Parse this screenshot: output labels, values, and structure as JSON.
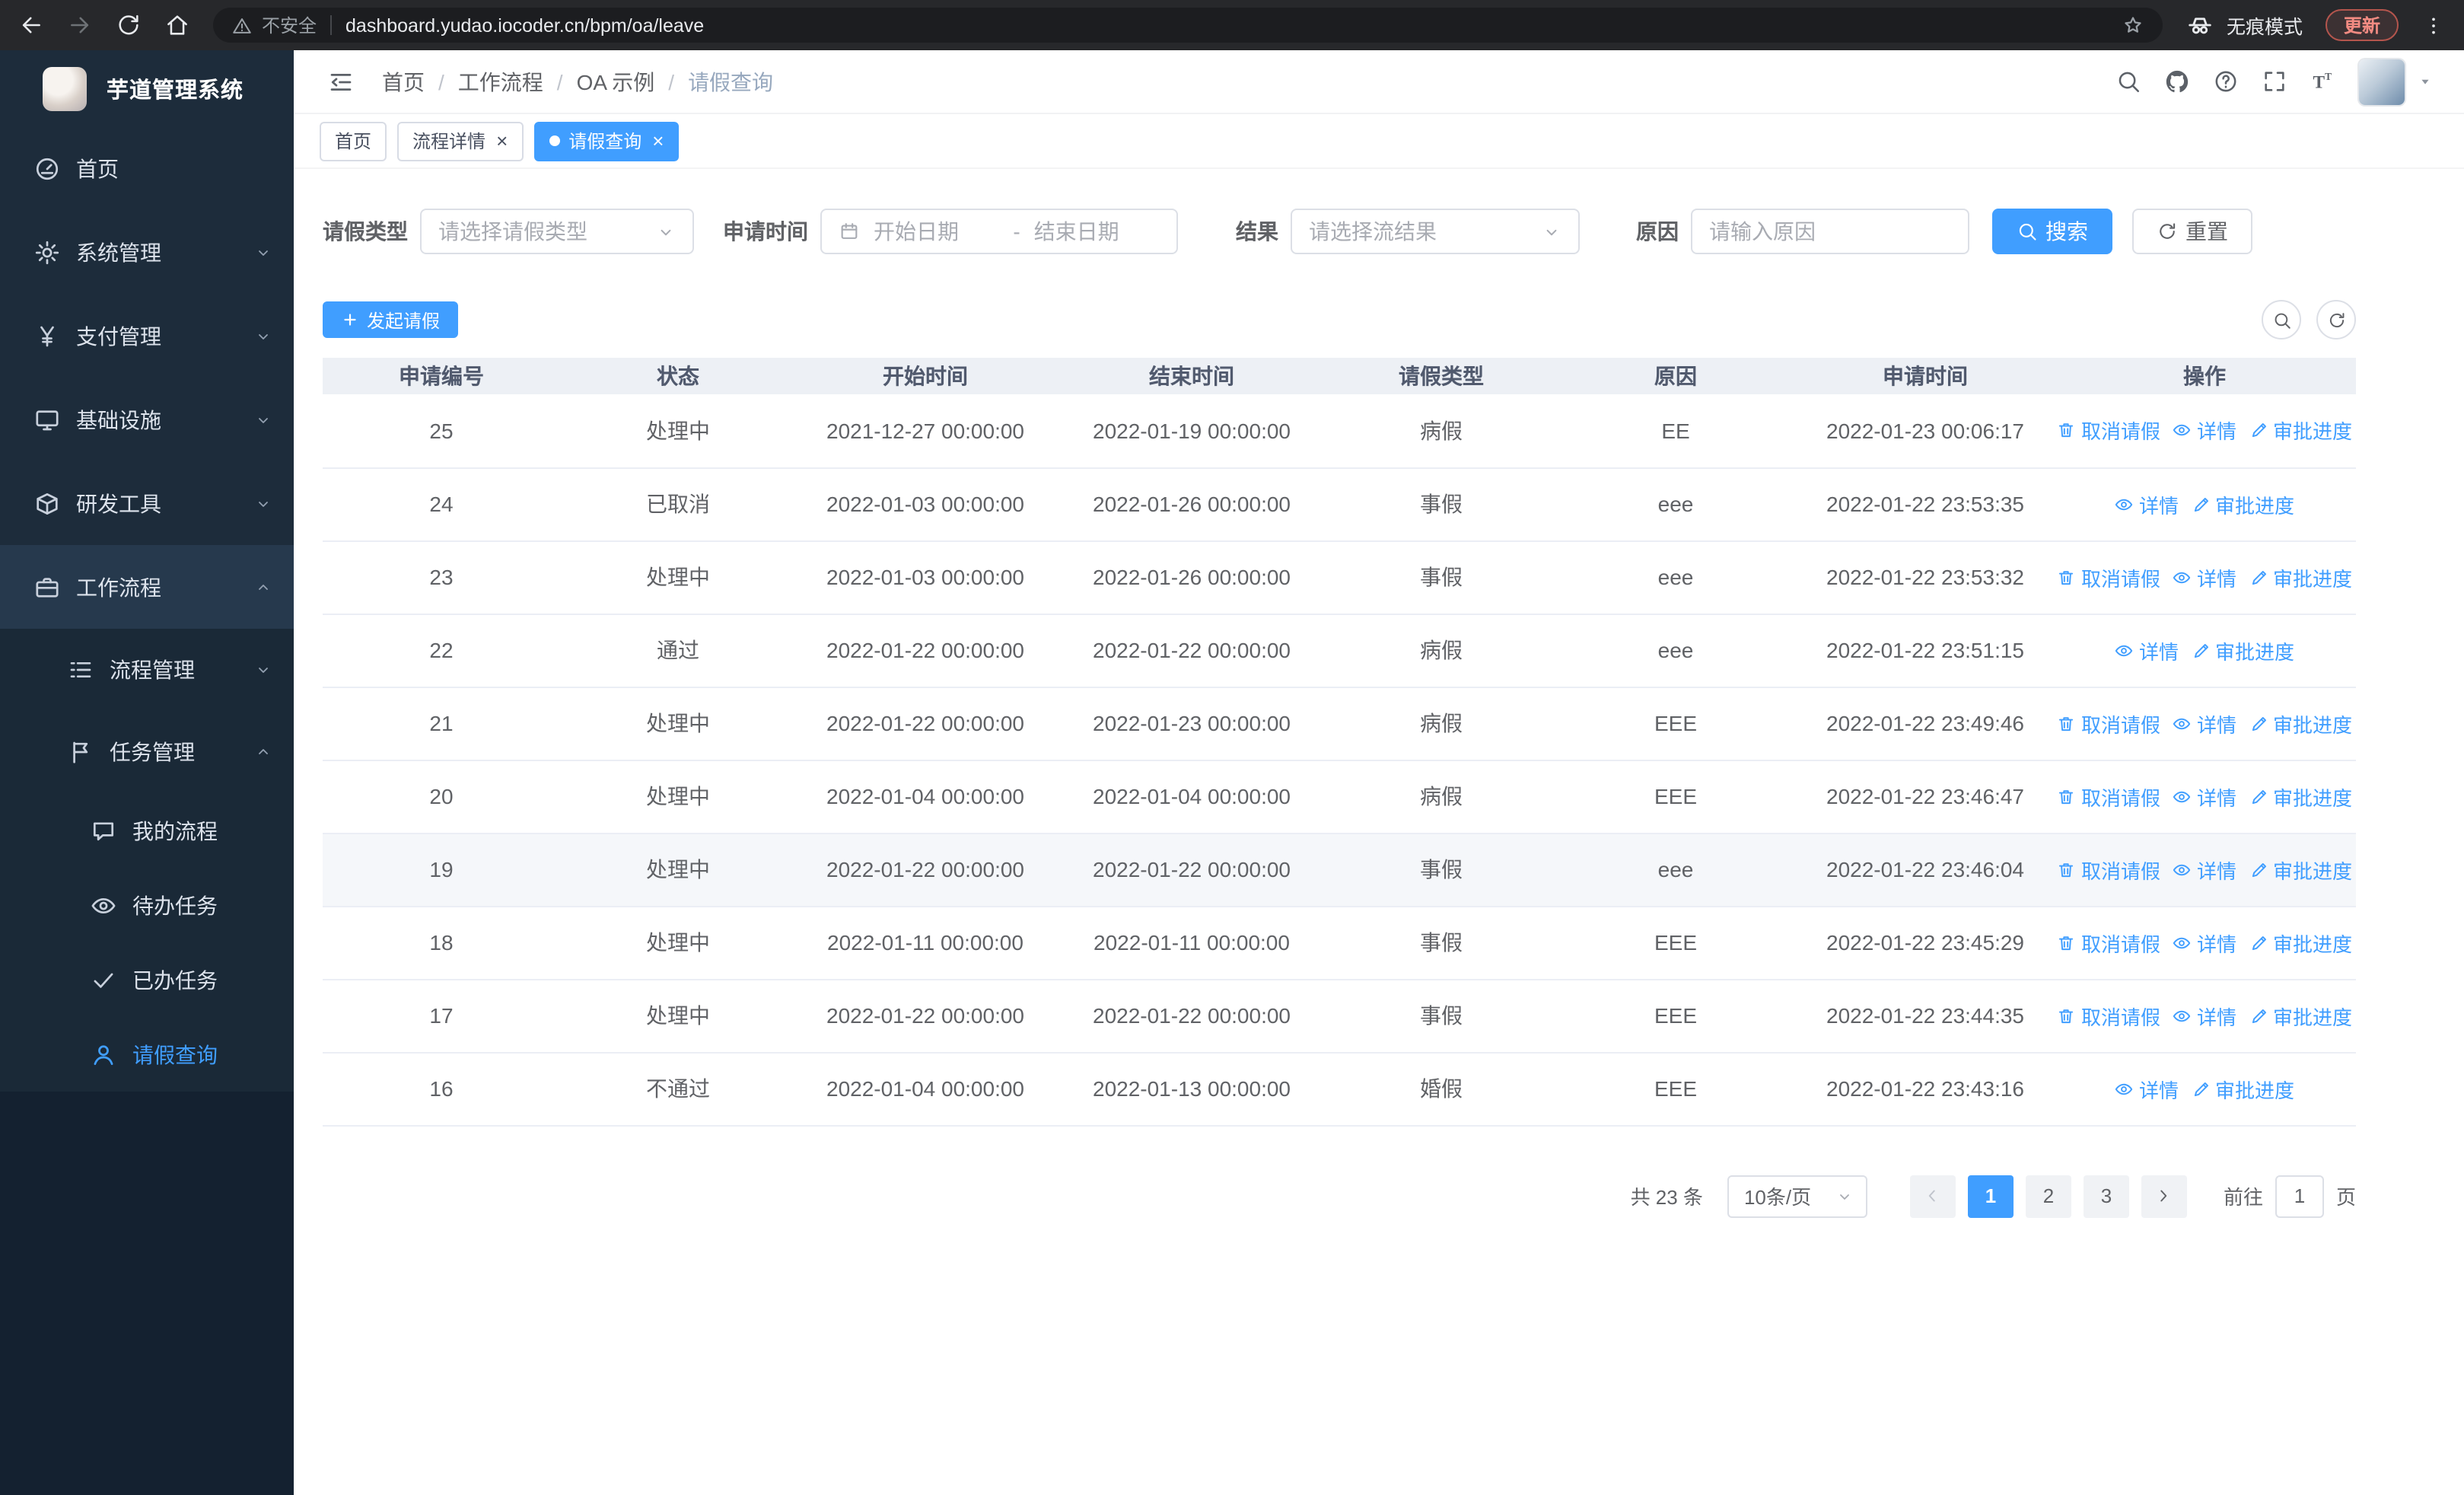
{
  "browser": {
    "security_label": "不安全",
    "url": "dashboard.yudao.iocoder.cn/bpm/oa/leave",
    "incognito_label": "无痕模式",
    "update_label": "更新"
  },
  "sidebar": {
    "logo_title": "芋道管理系统",
    "items": [
      {
        "label": "首页",
        "icon": "dashboard-icon",
        "level": 1
      },
      {
        "label": "系统管理",
        "icon": "gear-icon",
        "level": 1,
        "expandable": true
      },
      {
        "label": "支付管理",
        "icon": "yen-icon",
        "level": 1,
        "expandable": true
      },
      {
        "label": "基础设施",
        "icon": "monitor-icon",
        "level": 1,
        "expandable": true
      },
      {
        "label": "研发工具",
        "icon": "cube-icon",
        "level": 1,
        "expandable": true
      },
      {
        "label": "工作流程",
        "icon": "briefcase-icon",
        "level": 1,
        "expandable": true,
        "expanded": true,
        "highlighted": true
      },
      {
        "label": "流程管理",
        "icon": "list-icon",
        "level": 2,
        "expandable": true
      },
      {
        "label": "任务管理",
        "icon": "flag-icon",
        "level": 2,
        "expandable": true,
        "expanded": true
      },
      {
        "label": "我的流程",
        "icon": "chat-icon",
        "level": 3
      },
      {
        "label": "待办任务",
        "icon": "eye-icon",
        "level": 3
      },
      {
        "label": "已办任务",
        "icon": "check-icon",
        "level": 3
      },
      {
        "label": "请假查询",
        "icon": "user-icon",
        "level": 3,
        "active": true
      }
    ]
  },
  "header": {
    "breadcrumb": [
      "首页",
      "工作流程",
      "OA 示例",
      "请假查询"
    ]
  },
  "tabs": [
    {
      "label": "首页"
    },
    {
      "label": "流程详情",
      "closable": true
    },
    {
      "label": "请假查询",
      "closable": true,
      "active": true
    }
  ],
  "filters": {
    "leave_type_label": "请假类型",
    "leave_type_placeholder": "请选择请假类型",
    "apply_time_label": "申请时间",
    "start_date_placeholder": "开始日期",
    "range_separator": "-",
    "end_date_placeholder": "结束日期",
    "result_label": "结果",
    "result_placeholder": "请选择流结果",
    "reason_label": "原因",
    "reason_placeholder": "请输入原因",
    "search_button": "搜索",
    "reset_button": "重置"
  },
  "toolbar": {
    "create_button": "发起请假"
  },
  "table": {
    "columns": [
      "申请编号",
      "状态",
      "开始时间",
      "结束时间",
      "请假类型",
      "原因",
      "申请时间",
      "操作"
    ],
    "action_icons": {
      "取消请假": "delete-icon",
      "详情": "view-icon",
      "审批进度": "progress-icon"
    },
    "rows": [
      {
        "id": "25",
        "status": "处理中",
        "start": "2021-12-27 00:00:00",
        "end": "2022-01-19 00:00:00",
        "type": "病假",
        "reason": "EE",
        "applied": "2022-01-23 00:06:17",
        "actions": [
          "取消请假",
          "详情",
          "审批进度"
        ]
      },
      {
        "id": "24",
        "status": "已取消",
        "start": "2022-01-03 00:00:00",
        "end": "2022-01-26 00:00:00",
        "type": "事假",
        "reason": "eee",
        "applied": "2022-01-22 23:53:35",
        "actions": [
          "详情",
          "审批进度"
        ]
      },
      {
        "id": "23",
        "status": "处理中",
        "start": "2022-01-03 00:00:00",
        "end": "2022-01-26 00:00:00",
        "type": "事假",
        "reason": "eee",
        "applied": "2022-01-22 23:53:32",
        "actions": [
          "取消请假",
          "详情",
          "审批进度"
        ]
      },
      {
        "id": "22",
        "status": "通过",
        "start": "2022-01-22 00:00:00",
        "end": "2022-01-22 00:00:00",
        "type": "病假",
        "reason": "eee",
        "applied": "2022-01-22 23:51:15",
        "actions": [
          "详情",
          "审批进度"
        ]
      },
      {
        "id": "21",
        "status": "处理中",
        "start": "2022-01-22 00:00:00",
        "end": "2022-01-23 00:00:00",
        "type": "病假",
        "reason": "EEE",
        "applied": "2022-01-22 23:49:46",
        "actions": [
          "取消请假",
          "详情",
          "审批进度"
        ]
      },
      {
        "id": "20",
        "status": "处理中",
        "start": "2022-01-04 00:00:00",
        "end": "2022-01-04 00:00:00",
        "type": "病假",
        "reason": "EEE",
        "applied": "2022-01-22 23:46:47",
        "actions": [
          "取消请假",
          "详情",
          "审批进度"
        ]
      },
      {
        "id": "19",
        "status": "处理中",
        "start": "2022-01-22 00:00:00",
        "end": "2022-01-22 00:00:00",
        "type": "事假",
        "reason": "eee",
        "applied": "2022-01-22 23:46:04",
        "actions": [
          "取消请假",
          "详情",
          "审批进度"
        ],
        "highlighted": true
      },
      {
        "id": "18",
        "status": "处理中",
        "start": "2022-01-11 00:00:00",
        "end": "2022-01-11 00:00:00",
        "type": "事假",
        "reason": "EEE",
        "applied": "2022-01-22 23:45:29",
        "actions": [
          "取消请假",
          "详情",
          "审批进度"
        ]
      },
      {
        "id": "17",
        "status": "处理中",
        "start": "2022-01-22 00:00:00",
        "end": "2022-01-22 00:00:00",
        "type": "事假",
        "reason": "EEE",
        "applied": "2022-01-22 23:44:35",
        "actions": [
          "取消请假",
          "详情",
          "审批进度"
        ]
      },
      {
        "id": "16",
        "status": "不通过",
        "start": "2022-01-04 00:00:00",
        "end": "2022-01-13 00:00:00",
        "type": "婚假",
        "reason": "EEE",
        "applied": "2022-01-22 23:43:16",
        "actions": [
          "详情",
          "审批进度"
        ]
      }
    ]
  },
  "pagination": {
    "total_label": "共 23 条",
    "page_size": "10条/页",
    "pages": [
      "1",
      "2",
      "3"
    ],
    "current_page": "1",
    "goto_label": "前往",
    "goto_value": "1",
    "goto_suffix": "页"
  },
  "colors": {
    "primary": "#409eff",
    "sidebar_bg": "#1d2c3b",
    "table_header_bg": "#edf0f5",
    "active_tab_bg": "#409eff"
  }
}
